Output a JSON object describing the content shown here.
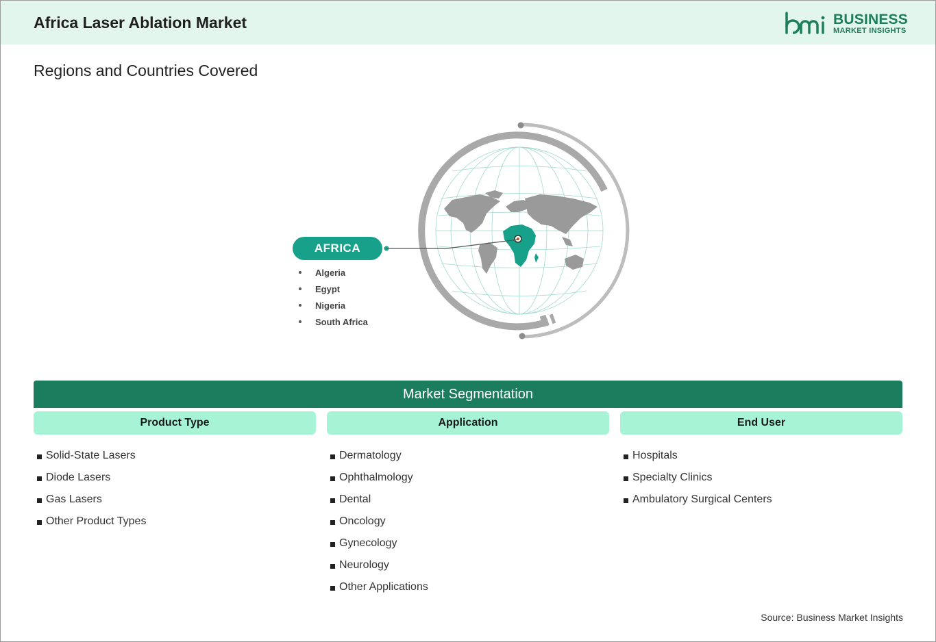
{
  "header": {
    "title": "Africa Laser Ablation Market",
    "logo": {
      "mark": "bmi",
      "line1": "BUSINESS",
      "line2": "MARKET INSIGHTS",
      "color": "#1e7d5d"
    }
  },
  "regions": {
    "title": "Regions and Countries Covered",
    "region_label": "AFRICA",
    "countries": [
      "Algeria",
      "Egypt",
      "Nigeria",
      "South Africa"
    ],
    "accent_color": "#17a08a"
  },
  "segmentation": {
    "title": "Market Segmentation",
    "columns": [
      {
        "header": "Product Type",
        "items": [
          "Solid-State Lasers",
          "Diode Lasers",
          "Gas Lasers",
          "Other Product Types"
        ]
      },
      {
        "header": "Application",
        "items": [
          "Dermatology",
          "Ophthalmology",
          "Dental",
          "Oncology",
          "Gynecology",
          "Neurology",
          "Other Applications"
        ]
      },
      {
        "header": "End User",
        "items": [
          "Hospitals",
          "Specialty Clinics",
          "Ambulatory Surgical Centers"
        ]
      }
    ],
    "bar_color": "#1c7d5e",
    "header_color": "#a6f3d6"
  },
  "footer": {
    "source": "Source: Business Market Insights"
  }
}
